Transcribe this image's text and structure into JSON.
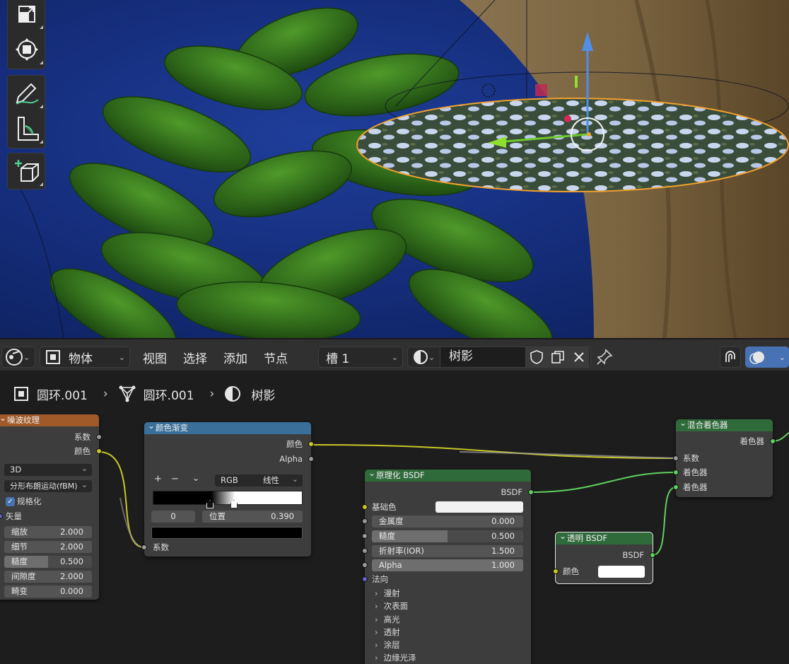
{
  "header": {
    "mode_label": "物体",
    "menus": [
      "视图",
      "选择",
      "添加",
      "节点"
    ],
    "slot_label": "槽 1",
    "material_name": "树影"
  },
  "breadcrumb": {
    "object": "圆环.001",
    "mesh": "圆环.001",
    "material": "树影"
  },
  "nodes": {
    "noise": {
      "title": "噪波纹理",
      "out_fac": "系数",
      "out_color": "颜色",
      "dimension": "3D",
      "type": "分形布朗运动(fBM)",
      "normalize_label": "规格化",
      "vector_label": "矢量",
      "fields": [
        {
          "label": "缩放",
          "value": "2.000"
        },
        {
          "label": "细节",
          "value": "2.000"
        },
        {
          "label": "糙度",
          "value": "0.500"
        },
        {
          "label": "间隙度",
          "value": "2.000"
        },
        {
          "label": "畸变",
          "value": "0.000"
        }
      ]
    },
    "ramp": {
      "title": "颜色渐变",
      "out_color": "颜色",
      "out_alpha": "Alpha",
      "plus": "+",
      "minus": "−",
      "color_mode": "RGB",
      "interp": "线性",
      "stop_index": "0",
      "pos_label": "位置",
      "pos_value": "0.390",
      "in_fac": "系数"
    },
    "principled": {
      "title": "原理化 BSDF",
      "out_bsdf": "BSDF",
      "base_color": "基础色",
      "fields": [
        {
          "label": "金属度",
          "value": "0.000"
        },
        {
          "label": "糙度",
          "value": "0.500"
        },
        {
          "label": "折射率(IOR)",
          "value": "1.500"
        },
        {
          "label": "Alpha",
          "value": "1.000"
        }
      ],
      "normal": "法向",
      "subpanels": [
        "漫射",
        "次表面",
        "高光",
        "透射",
        "涂层",
        "边缘光泽"
      ]
    },
    "transparent": {
      "title": "透明 BSDF",
      "out_bsdf": "BSDF",
      "in_color": "颜色"
    },
    "mix": {
      "title": "混合着色器",
      "out_shader": "着色器",
      "in_fac": "系数",
      "in_shader1": "着色器",
      "in_shader2": "着色器"
    }
  },
  "colors": {
    "noise_header": "#a05a2a",
    "ramp_header": "#3a6f9a",
    "shader_header": "#2f6a3a",
    "socket_yellow": "#c7c729",
    "socket_green": "#5fcf5f",
    "socket_gray": "#9a9a9a",
    "socket_blue": "#6363c7"
  }
}
